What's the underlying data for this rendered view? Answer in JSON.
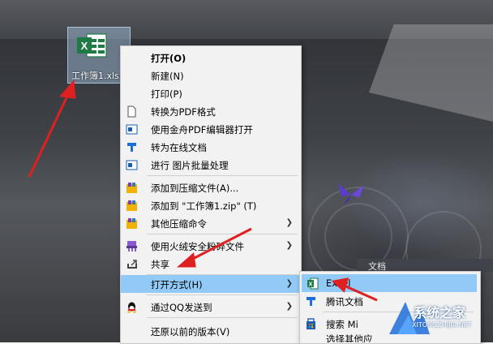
{
  "desktop": {
    "file_label": "工作簿1.xlsx"
  },
  "context_menu": {
    "items": [
      {
        "label": "打开(O)",
        "icon": "none",
        "bold": true
      },
      {
        "label": "新建(N)",
        "icon": "none"
      },
      {
        "label": "打印(P)",
        "icon": "none"
      },
      {
        "label": "转换为PDF格式",
        "icon": "document-icon"
      },
      {
        "label": "使用金舟PDF编辑器打开",
        "icon": "pdf-editor-icon"
      },
      {
        "label": "转为在线文档",
        "icon": "tencent-docs-icon"
      },
      {
        "label": "进行 图片批量处理",
        "icon": "image-batch-icon"
      },
      {
        "label": "添加到压缩文件(A)...",
        "icon": "archive-icon"
      },
      {
        "label": "添加到 \"工作簿1.zip\" (T)",
        "icon": "archive-icon"
      },
      {
        "label": "其他压缩命令",
        "icon": "archive-icon",
        "submenu": true
      },
      {
        "label": "使用火绒安全粉碎文件",
        "icon": "shredder-icon",
        "submenu": true
      },
      {
        "label": "共享",
        "icon": "share-icon"
      },
      {
        "label": "打开方式(H)",
        "icon": "none",
        "submenu": true,
        "highlighted": true
      },
      {
        "label": "通过QQ发送到",
        "icon": "qq-icon",
        "submenu": true
      },
      {
        "label": "还原以前的版本(V)",
        "icon": "none"
      }
    ]
  },
  "open_with_submenu": {
    "tab_label": "文档",
    "items": [
      {
        "label": "Excel",
        "icon": "excel-icon",
        "highlighted": true
      },
      {
        "label": "腾讯文档",
        "icon": "tencent-docs-icon"
      },
      {
        "label": "搜索 Mi",
        "icon": "store-icon"
      },
      {
        "label": "选择其他应",
        "icon": "none"
      }
    ]
  },
  "watermark": {
    "title": "系统之家",
    "url": "XITONGZHIJIA.NET"
  },
  "colors": {
    "highlight": "#91c9f7",
    "arrow": "#e02020",
    "excel_green": "#1f7a43"
  }
}
